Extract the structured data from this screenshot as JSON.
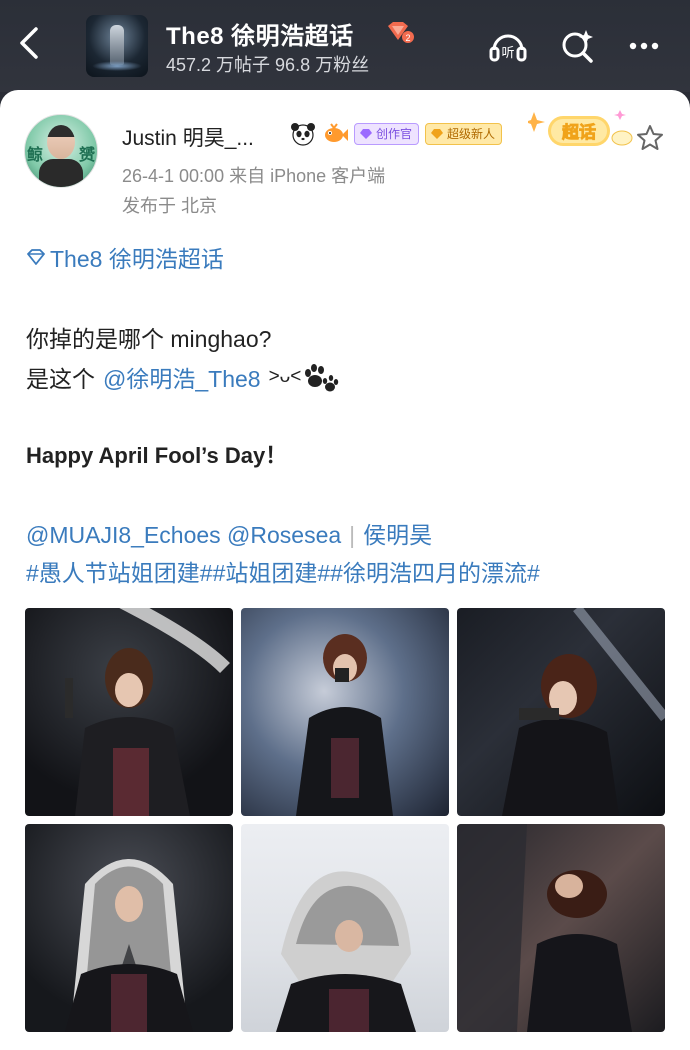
{
  "header": {
    "title": "The8 徐明浩超话",
    "stats": "457.2 万帖子 96.8 万粉丝",
    "level_badge_text": "2",
    "icons": [
      "back-arrow-icon",
      "listen-icon",
      "search-sparkle-icon",
      "more-icon"
    ],
    "listen_label": "听"
  },
  "post": {
    "author": "Justin 明昊_...",
    "badges": {
      "creator": "创作官",
      "new_member": "超级新人",
      "chaohua": "超话"
    },
    "time": "26-4-1 00:00  来自 iPhone 客户端",
    "location": "发布于 北京",
    "topic": "The8 徐明浩超话",
    "line1": "你掉的是哪个 minghao?",
    "line2_prefix": "是这个",
    "line2_mention": "@徐明浩_The8",
    "line2_emoticon": ">ᴗ<",
    "headline": "Happy April Fool’s Day！",
    "mention1": "@MUAJI8_Echoes",
    "mention2": "@Rosesea",
    "separator": "|",
    "mention3": "侯明昊",
    "hashtags": "#愚人节站姐团建##站姐团建##徐明浩四月的漂流#"
  },
  "colors": {
    "link": "#3a7bbd",
    "header_bg": "#2b2f38",
    "creator_badge": "#7a4fe0",
    "new_badge": "#f2c24b"
  },
  "photos": [
    {
      "name": "performer-with-mic-on-dark-stage"
    },
    {
      "name": "performer-singing-with-blue-lights"
    },
    {
      "name": "performer-singing-side-view"
    },
    {
      "name": "performer-with-checkered-scarf"
    },
    {
      "name": "performer-covering-head-with-scarf"
    },
    {
      "name": "performer-looking-up"
    }
  ]
}
